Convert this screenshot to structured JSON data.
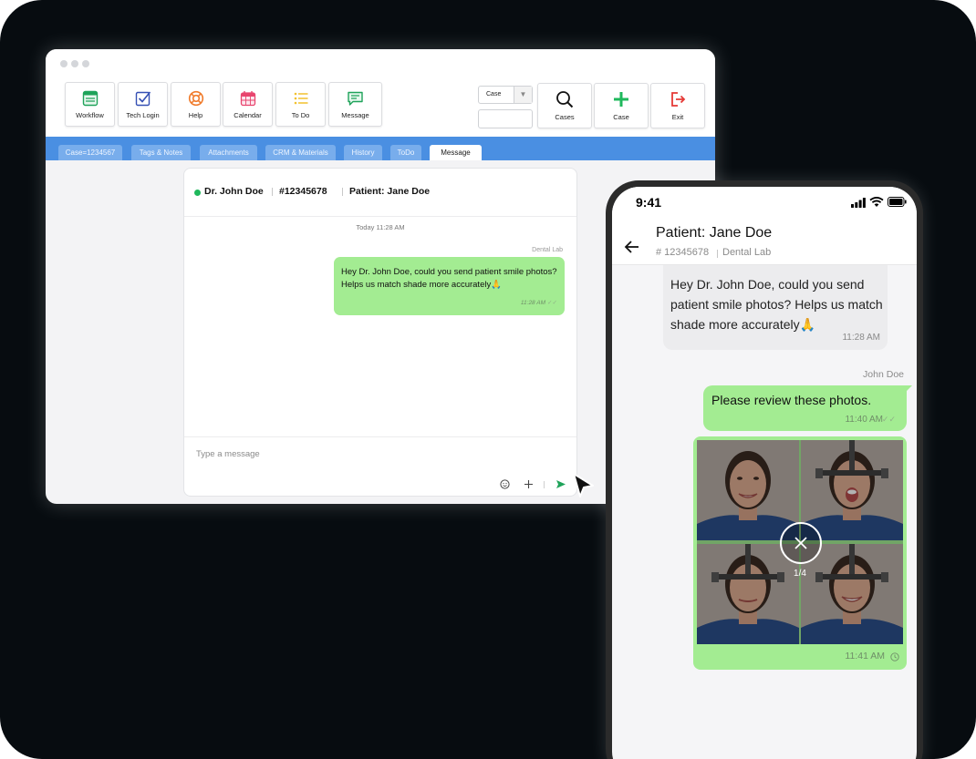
{
  "desktop": {
    "toolbar": {
      "buttons": [
        {
          "label": "Workflow",
          "icon": "workflow-icon"
        },
        {
          "label": "Tech Login",
          "icon": "checkbox-icon"
        },
        {
          "label": "Help",
          "icon": "lifebuoy-icon"
        },
        {
          "label": "Calendar",
          "icon": "calendar-icon"
        },
        {
          "label": "To Do",
          "icon": "list-icon"
        },
        {
          "label": "Message",
          "icon": "message-icon"
        }
      ],
      "case_select": {
        "value": "Case"
      },
      "case_input": {
        "value": ""
      },
      "cases_label": "Cases",
      "new_case_label": "Case",
      "exit_label": "Exit"
    },
    "tabs": [
      "Case=1234567",
      "Tags & Notes",
      "Attachments",
      "CRM & Materials",
      "History",
      "ToDo",
      "Message"
    ],
    "active_tab": "Message",
    "chat": {
      "doctor": "Dr. John Doe",
      "case_number": "#12345678",
      "patient": "Patient: Jane Doe",
      "day_label": "Today 11:28 AM",
      "sender": "Dental Lab",
      "message": "Hey Dr. John Doe, could you send patient smile photos? Helps us match shade more accurately🙏",
      "time": "11:28 AM",
      "composer_placeholder": "Type a message"
    }
  },
  "phone": {
    "status_time": "9:41",
    "title": "Patient: Jane Doe",
    "case_number": "# 12345678",
    "lab": "Dental Lab",
    "incoming": {
      "message": "Hey Dr. John Doe, could you send patient smile photos? Helps us match shade more accurately🙏",
      "time": "11:28 AM"
    },
    "sender": "John Doe",
    "outgoing": {
      "message": "Please review these photos.",
      "time": "11:40 AM"
    },
    "photos": {
      "counter": "1/4",
      "time": "11:41 AM",
      "count": 4
    }
  },
  "colors": {
    "background": "#070c10",
    "tabbar": "#4a8fe2",
    "bubble_green": "#a3ec92",
    "online_dot": "#1fb85c",
    "add_green": "#1fb85c",
    "exit_red": "#e53935"
  }
}
